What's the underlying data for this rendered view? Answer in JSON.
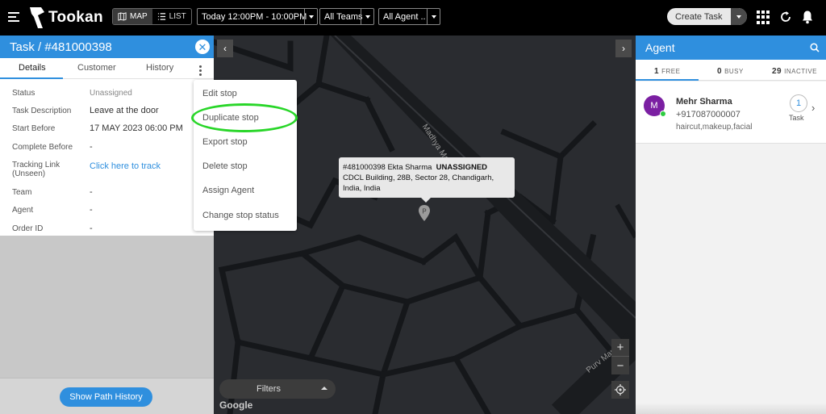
{
  "topbar": {
    "logo_text": "Tookan",
    "map_label": "MAP",
    "list_label": "LIST",
    "time_filter": "Today 12:00PM - 10:00PM",
    "team_filter": "All Teams",
    "agent_filter": "All Agent ..",
    "create_task_label": "Create Task"
  },
  "task": {
    "title": "Task / #481000398",
    "tabs": [
      "Details",
      "Customer",
      "History"
    ],
    "fields": [
      {
        "label": "Status",
        "value": "Unassigned"
      },
      {
        "label": "Task Description",
        "value": "Leave at the door"
      },
      {
        "label": "Start Before",
        "value": "17 MAY 2023 06:00 PM"
      },
      {
        "label": "Complete Before",
        "value": "-"
      },
      {
        "label": "Tracking Link",
        "label2": "(Unseen)",
        "value": "Click here to track"
      },
      {
        "label": "Team",
        "value": "-"
      },
      {
        "label": "Agent",
        "value": "-"
      },
      {
        "label": "Order ID",
        "value": "-"
      }
    ],
    "show_path_label": "Show Path History"
  },
  "menu": {
    "items": [
      "Edit stop",
      "Duplicate stop",
      "Export stop",
      "Delete stop",
      "Assign Agent",
      "Change stop status"
    ]
  },
  "map": {
    "tooltip_id_name": "#481000398 Ekta Sharma",
    "tooltip_status": "UNASSIGNED",
    "tooltip_address_1": "CDCL Building, 28B, Sector 28, Chandigarh,",
    "tooltip_address_2": "India, India",
    "street_1": "Madhya Marg",
    "street_2": "Purv Marg",
    "filters_label": "Filters",
    "google_label": "Google"
  },
  "agents": {
    "title": "Agent",
    "tabs": [
      {
        "count": "1",
        "label": "FREE"
      },
      {
        "count": "0",
        "label": "BUSY"
      },
      {
        "count": "29",
        "label": "INACTIVE"
      }
    ],
    "list": [
      {
        "initial": "M",
        "name": "Mehr Sharma",
        "phone": "+917087000007",
        "tags": "haircut,makeup,facial",
        "task_count": "1",
        "task_label": "Task"
      }
    ]
  }
}
